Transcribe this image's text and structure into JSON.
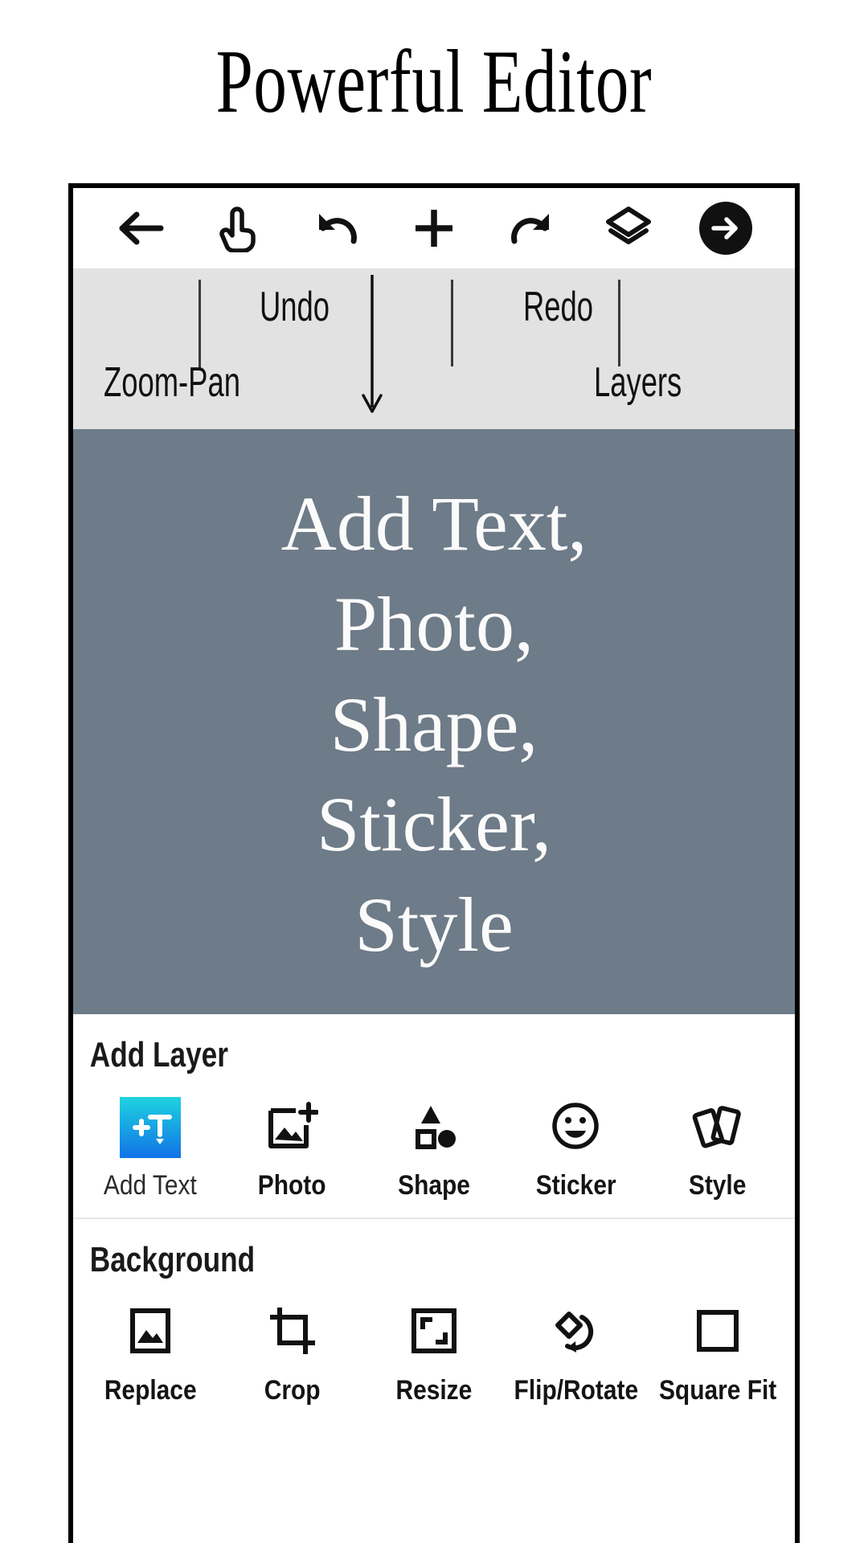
{
  "headline": "Powerful Editor",
  "toolbar": {
    "items": [
      {
        "name": "back-icon",
        "label": "Back"
      },
      {
        "name": "hand-icon",
        "label": "Zoom-Pan"
      },
      {
        "name": "undo-icon",
        "label": "Undo"
      },
      {
        "name": "plus-icon",
        "label": "Add"
      },
      {
        "name": "redo-icon",
        "label": "Redo"
      },
      {
        "name": "layers-icon",
        "label": "Layers"
      },
      {
        "name": "next-arrow-icon",
        "label": "Next"
      }
    ]
  },
  "annotations": {
    "undo": "Undo",
    "redo": "Redo",
    "zoom_pan": "Zoom-Pan",
    "layers": "Layers"
  },
  "canvas": {
    "lines": [
      "Add Text,",
      "Photo,",
      "Shape,",
      "Sticker,",
      "Style"
    ],
    "background_color": "#6e7b88",
    "text_color": "#fbfbfb"
  },
  "add_layer": {
    "title": "Add Layer",
    "tools": [
      {
        "label": "Add Text",
        "icon": "add-text-icon"
      },
      {
        "label": "Photo",
        "icon": "photo-add-icon"
      },
      {
        "label": "Shape",
        "icon": "shapes-icon"
      },
      {
        "label": "Sticker",
        "icon": "sticker-smiley-icon"
      },
      {
        "label": "Style",
        "icon": "style-cards-icon"
      }
    ],
    "accent_gradient": [
      "#1fd3e0",
      "#1173e6"
    ]
  },
  "background": {
    "title": "Background",
    "tools": [
      {
        "label": "Replace",
        "icon": "image-icon"
      },
      {
        "label": "Crop",
        "icon": "crop-icon"
      },
      {
        "label": "Resize",
        "icon": "resize-icon"
      },
      {
        "label": "Flip/Rotate",
        "icon": "flip-rotate-icon"
      },
      {
        "label": "Square Fit",
        "icon": "square-fit-icon"
      }
    ]
  }
}
